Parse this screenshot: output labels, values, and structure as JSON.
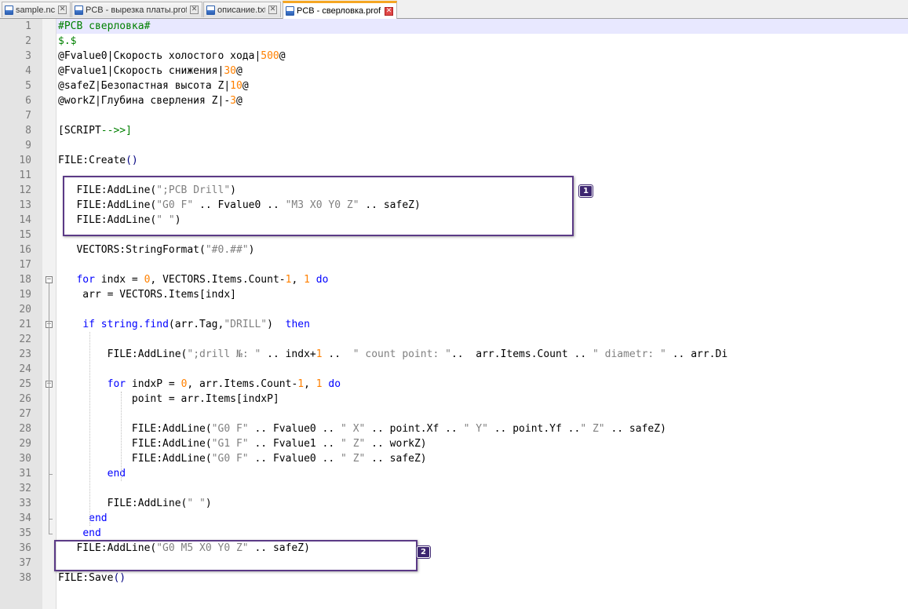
{
  "tabs": [
    {
      "label": "sample.nc",
      "active": false
    },
    {
      "label": "PCB - вырезка платы.prof",
      "active": false
    },
    {
      "label": "описание.txt",
      "active": false
    },
    {
      "label": "PCB - сверловка.prof",
      "active": true
    }
  ],
  "close_glyph": "✕",
  "fold_glyph": "−",
  "colors": {
    "comment": "#008000",
    "operator": "#000080",
    "number": "#ff8000",
    "string": "#808080",
    "keyword": "#0000ff",
    "text": "#000000",
    "callout": "#5b3a86",
    "active_tab_accent": "#f5a623",
    "current_line": "#e8e8ff"
  },
  "editor": {
    "current_line": 1,
    "lines": [
      {
        "n": "1",
        "tokens": [
          [
            "cmt",
            "#PCB сверловка#"
          ]
        ]
      },
      {
        "n": "2",
        "tokens": [
          [
            "cmt",
            "$.$"
          ]
        ]
      },
      {
        "n": "3",
        "tokens": [
          [
            "txt",
            "@Fvalue0|Скорость холостого хода|"
          ],
          [
            "num",
            "500"
          ],
          [
            "txt",
            "@"
          ]
        ]
      },
      {
        "n": "4",
        "tokens": [
          [
            "txt",
            "@Fvalue1|Скорость снижения|"
          ],
          [
            "num",
            "30"
          ],
          [
            "txt",
            "@"
          ]
        ]
      },
      {
        "n": "5",
        "tokens": [
          [
            "txt",
            "@safeZ|Безопастная высота Z|"
          ],
          [
            "num",
            "10"
          ],
          [
            "txt",
            "@"
          ]
        ]
      },
      {
        "n": "6",
        "tokens": [
          [
            "txt",
            "@workZ|Глубина сверления Z|-"
          ],
          [
            "num",
            "3"
          ],
          [
            "txt",
            "@"
          ]
        ]
      },
      {
        "n": "7",
        "tokens": []
      },
      {
        "n": "8",
        "tokens": [
          [
            "txt",
            "[SCRIPT"
          ],
          [
            "cmt",
            "-->>]"
          ]
        ]
      },
      {
        "n": "9",
        "tokens": []
      },
      {
        "n": "10",
        "tokens": [
          [
            "txt",
            "FILE:Create"
          ],
          [
            "op",
            "()"
          ]
        ]
      },
      {
        "n": "11",
        "tokens": []
      },
      {
        "n": "12",
        "tokens": [
          [
            "txt",
            "   FILE:AddLine("
          ],
          [
            "str",
            "\";PCB Drill\""
          ],
          [
            "txt",
            ")"
          ]
        ]
      },
      {
        "n": "13",
        "tokens": [
          [
            "txt",
            "   FILE:AddLine("
          ],
          [
            "str",
            "\"G0 F\""
          ],
          [
            "txt",
            " .. Fvalue0 .. "
          ],
          [
            "str",
            "\"M3 X0 Y0 Z\""
          ],
          [
            "txt",
            " .. safeZ)"
          ]
        ]
      },
      {
        "n": "14",
        "tokens": [
          [
            "txt",
            "   FILE:AddLine("
          ],
          [
            "str",
            "\" \""
          ],
          [
            "txt",
            ")"
          ]
        ]
      },
      {
        "n": "15",
        "tokens": []
      },
      {
        "n": "16",
        "tokens": [
          [
            "txt",
            "   VECTORS:StringFormat("
          ],
          [
            "str",
            "\"#0.##\""
          ],
          [
            "txt",
            ")"
          ]
        ]
      },
      {
        "n": "17",
        "tokens": []
      },
      {
        "n": "18",
        "tokens": [
          [
            "txt",
            "   "
          ],
          [
            "kw",
            "for"
          ],
          [
            "txt",
            " indx = "
          ],
          [
            "num",
            "0"
          ],
          [
            "txt",
            ", VECTORS.Items.Count-"
          ],
          [
            "num",
            "1"
          ],
          [
            "txt",
            ", "
          ],
          [
            "num",
            "1"
          ],
          [
            "txt",
            " "
          ],
          [
            "kw",
            "do"
          ]
        ]
      },
      {
        "n": "19",
        "tokens": [
          [
            "txt",
            "    arr = VECTORS.Items[indx]"
          ]
        ]
      },
      {
        "n": "20",
        "tokens": []
      },
      {
        "n": "21",
        "tokens": [
          [
            "txt",
            "    "
          ],
          [
            "kw",
            "if"
          ],
          [
            "txt",
            " "
          ],
          [
            "kw",
            "string.find"
          ],
          [
            "txt",
            "(arr.Tag,"
          ],
          [
            "str",
            "\"DRILL\""
          ],
          [
            "txt",
            ")  "
          ],
          [
            "kw",
            "then"
          ]
        ]
      },
      {
        "n": "22",
        "tokens": []
      },
      {
        "n": "23",
        "tokens": [
          [
            "txt",
            "        FILE:AddLine("
          ],
          [
            "str",
            "\";drill №: \""
          ],
          [
            "txt",
            " .. indx+"
          ],
          [
            "num",
            "1"
          ],
          [
            "txt",
            " ..  "
          ],
          [
            "str",
            "\" count point: \""
          ],
          [
            "txt",
            "..  arr.Items.Count .. "
          ],
          [
            "str",
            "\" diametr: \""
          ],
          [
            "txt",
            " .. arr.Di"
          ]
        ]
      },
      {
        "n": "24",
        "tokens": []
      },
      {
        "n": "25",
        "tokens": [
          [
            "txt",
            "        "
          ],
          [
            "kw",
            "for"
          ],
          [
            "txt",
            " indxP = "
          ],
          [
            "num",
            "0"
          ],
          [
            "txt",
            ", arr.Items.Count-"
          ],
          [
            "num",
            "1"
          ],
          [
            "txt",
            ", "
          ],
          [
            "num",
            "1"
          ],
          [
            "txt",
            " "
          ],
          [
            "kw",
            "do"
          ]
        ]
      },
      {
        "n": "26",
        "tokens": [
          [
            "txt",
            "            point = arr.Items[indxP]"
          ]
        ]
      },
      {
        "n": "27",
        "tokens": []
      },
      {
        "n": "28",
        "tokens": [
          [
            "txt",
            "            FILE:AddLine("
          ],
          [
            "str",
            "\"G0 F\""
          ],
          [
            "txt",
            " .. Fvalue0 .. "
          ],
          [
            "str",
            "\" X\""
          ],
          [
            "txt",
            " .. point.Xf .. "
          ],
          [
            "str",
            "\" Y\""
          ],
          [
            "txt",
            " .. point.Yf .."
          ],
          [
            "str",
            "\" Z\""
          ],
          [
            "txt",
            " .. safeZ)"
          ]
        ]
      },
      {
        "n": "29",
        "tokens": [
          [
            "txt",
            "            FILE:AddLine("
          ],
          [
            "str",
            "\"G1 F\""
          ],
          [
            "txt",
            " .. Fvalue1 .. "
          ],
          [
            "str",
            "\" Z\""
          ],
          [
            "txt",
            " .. workZ)"
          ]
        ]
      },
      {
        "n": "30",
        "tokens": [
          [
            "txt",
            "            FILE:AddLine("
          ],
          [
            "str",
            "\"G0 F\""
          ],
          [
            "txt",
            " .. Fvalue0 .. "
          ],
          [
            "str",
            "\" Z\""
          ],
          [
            "txt",
            " .. safeZ)"
          ]
        ]
      },
      {
        "n": "31",
        "tokens": [
          [
            "txt",
            "        "
          ],
          [
            "kw",
            "end"
          ]
        ]
      },
      {
        "n": "32",
        "tokens": []
      },
      {
        "n": "33",
        "tokens": [
          [
            "txt",
            "        FILE:AddLine("
          ],
          [
            "str",
            "\" \""
          ],
          [
            "txt",
            ")"
          ]
        ]
      },
      {
        "n": "34",
        "tokens": [
          [
            "txt",
            "     "
          ],
          [
            "kw",
            "end"
          ]
        ]
      },
      {
        "n": "35",
        "tokens": [
          [
            "txt",
            "    "
          ],
          [
            "kw",
            "end"
          ]
        ]
      },
      {
        "n": "36",
        "tokens": [
          [
            "txt",
            "   FILE:AddLine("
          ],
          [
            "str",
            "\"G0 M5 X0 Y0 Z\""
          ],
          [
            "txt",
            " .. safeZ)"
          ]
        ]
      },
      {
        "n": "37",
        "tokens": []
      },
      {
        "n": "38",
        "tokens": [
          [
            "txt",
            "FILE:Save"
          ],
          [
            "op",
            "()"
          ]
        ]
      }
    ]
  },
  "callouts": [
    {
      "label": "1",
      "first_line": 12,
      "last_line": 14
    },
    {
      "label": "2",
      "first_line": 36,
      "last_line": 37
    }
  ]
}
